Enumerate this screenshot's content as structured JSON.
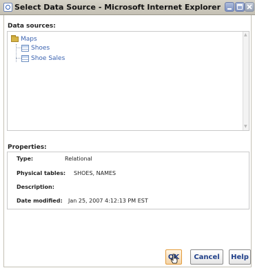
{
  "window": {
    "title": "Select Data Source - Microsoft Internet Explorer",
    "icon": "ie-page-icon",
    "controls": [
      "minimize-icon",
      "maximize-icon",
      "close-icon"
    ]
  },
  "data_sources": {
    "label": "Data sources:",
    "tree": [
      {
        "label": "Maps",
        "icon": "folder-icon",
        "level": 0
      },
      {
        "label": "Shoes",
        "icon": "table-icon",
        "level": 1
      },
      {
        "label": "Shoe Sales",
        "icon": "table-icon",
        "level": 1
      }
    ]
  },
  "properties": {
    "label": "Properties:",
    "rows": [
      {
        "key": "Type:",
        "value": "Relational"
      },
      {
        "key": "Physical tables:",
        "value": "SHOES, NAMES"
      },
      {
        "key": "Description:",
        "value": ""
      },
      {
        "key": "Date modified:",
        "value": "Jan 25, 2007 4:12:13 PM EST"
      }
    ]
  },
  "buttons": {
    "ok": "OK",
    "cancel": "Cancel",
    "help": "Help"
  }
}
